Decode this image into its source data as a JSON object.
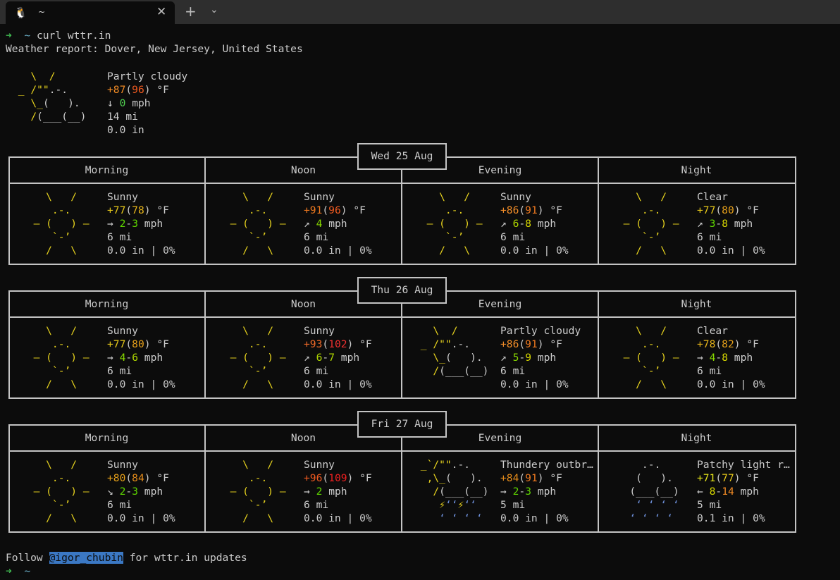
{
  "tab": {
    "title": "~",
    "icon": "linux-penguin-icon",
    "close_icon": "close-icon",
    "new_tab_icon": "plus-icon",
    "dropdown_icon": "chevron-down-icon"
  },
  "prompt": {
    "arrow": "➜",
    "dir": "~",
    "command": "curl wttr.in"
  },
  "report_title": "Weather report: Dover, New Jersey, United States",
  "colors": {
    "text": "#cccccc",
    "sun": "#e6d21e",
    "cloud": "#cccccc",
    "rain": "#6c8ed8",
    "prompt_arrow": "#3fb950",
    "prompt_dir": "#6ab0c8",
    "link_bg": "#3b78c4"
  },
  "art": {
    "sunny": [
      [
        [
          "    \\   /    ",
          "sun"
        ]
      ],
      [
        [
          "     .-.     ",
          "sun"
        ]
      ],
      [
        [
          "  ― (   ) ―  ",
          "sun"
        ]
      ],
      [
        [
          "     `-’     ",
          "sun"
        ]
      ],
      [
        [
          "    /   \\    ",
          "sun"
        ]
      ]
    ],
    "partly_cloudy": [
      [
        [
          "   \\  /      ",
          "sun"
        ]
      ],
      [
        [
          " _ /\"\"",
          "sun"
        ],
        [
          ".-.    ",
          "cloud"
        ]
      ],
      [
        [
          "   \\_",
          "sun"
        ],
        [
          "(   ).  ",
          "cloud"
        ]
      ],
      [
        [
          "   /",
          "sun"
        ],
        [
          "(___(__) ",
          "cloud"
        ]
      ],
      [
        [
          "             ",
          "cloud"
        ]
      ]
    ],
    "thundery": [
      [
        [
          " _`/\"\"",
          "sun"
        ],
        [
          ".-.    ",
          "cloud"
        ]
      ],
      [
        [
          "  ,\\_",
          "sun"
        ],
        [
          "(   ).  ",
          "cloud"
        ]
      ],
      [
        [
          "   /",
          "sun"
        ],
        [
          "(___(__) ",
          "cloud"
        ]
      ],
      [
        [
          "    ⚡",
          "sun"
        ],
        [
          "‘‘",
          "rain"
        ],
        [
          "⚡",
          "sun"
        ],
        [
          "‘‘ ",
          "rain"
        ]
      ],
      [
        [
          "    ‘ ‘ ‘ ‘  ",
          "rain"
        ]
      ]
    ],
    "patchy_rain": [
      [
        [
          "     .-.     ",
          "cloud"
        ]
      ],
      [
        [
          "    (   ).   ",
          "cloud"
        ]
      ],
      [
        [
          "   (___(__)  ",
          "cloud"
        ]
      ],
      [
        [
          "    ‘ ‘ ‘ ‘  ",
          "rain"
        ]
      ],
      [
        [
          "   ‘ ‘ ‘ ‘   ",
          "rain"
        ]
      ]
    ]
  },
  "current": {
    "art": "partly_cloudy",
    "condition": "Partly cloudy",
    "temp": {
      "v": "+87",
      "c": "#f08a24"
    },
    "feels": {
      "v": "96",
      "c": "#f05a20"
    },
    "temp_unit": "°F",
    "wind_arrow": "↓",
    "wind": [
      {
        "v": "0",
        "c": "#4fd04f"
      }
    ],
    "wind_unit": "mph",
    "visibility": "14 mi",
    "precip": "0.0 in"
  },
  "days": [
    {
      "date": "Wed 25 Aug",
      "periods": [
        {
          "label": "Morning",
          "art": "sunny",
          "condition": "Sunny",
          "temp": {
            "v": "+77",
            "c": "#e6c81a"
          },
          "feels": {
            "v": "78",
            "c": "#e6b41a"
          },
          "wind_arrow": "→",
          "wind": [
            {
              "v": "2",
              "c": "#5fd700"
            },
            {
              "v": "3",
              "c": "#5fd700"
            }
          ],
          "visibility": "6 mi",
          "precip": "0.0 in | 0%"
        },
        {
          "label": "Noon",
          "art": "sunny",
          "condition": "Sunny",
          "temp": {
            "v": "+91",
            "c": "#f07a20"
          },
          "feels": {
            "v": "96",
            "c": "#f05a20"
          },
          "wind_arrow": "↗",
          "wind": [
            {
              "v": "4",
              "c": "#87d700"
            }
          ],
          "visibility": "6 mi",
          "precip": "0.0 in | 0%"
        },
        {
          "label": "Evening",
          "art": "sunny",
          "condition": "Sunny",
          "temp": {
            "v": "+86",
            "c": "#f08c28"
          },
          "feels": {
            "v": "91",
            "c": "#f07a20"
          },
          "wind_arrow": "↗",
          "wind": [
            {
              "v": "6",
              "c": "#afd700"
            },
            {
              "v": "8",
              "c": "#d7d700"
            }
          ],
          "visibility": "6 mi",
          "precip": "0.0 in | 0%"
        },
        {
          "label": "Night",
          "art": "sunny",
          "condition": "Clear",
          "temp": {
            "v": "+77",
            "c": "#e6c81a"
          },
          "feels": {
            "v": "80",
            "c": "#e6a01a"
          },
          "wind_arrow": "↗",
          "wind": [
            {
              "v": "3",
              "c": "#5fd700"
            },
            {
              "v": "8",
              "c": "#d7d700"
            }
          ],
          "visibility": "6 mi",
          "precip": "0.0 in | 0%"
        }
      ]
    },
    {
      "date": "Thu 26 Aug",
      "periods": [
        {
          "label": "Morning",
          "art": "sunny",
          "condition": "Sunny",
          "temp": {
            "v": "+77",
            "c": "#e6c81a"
          },
          "feels": {
            "v": "80",
            "c": "#e6a01a"
          },
          "wind_arrow": "→",
          "wind": [
            {
              "v": "4",
              "c": "#87d700"
            },
            {
              "v": "6",
              "c": "#afd700"
            }
          ],
          "visibility": "6 mi",
          "precip": "0.0 in | 0%"
        },
        {
          "label": "Noon",
          "art": "sunny",
          "condition": "Sunny",
          "temp": {
            "v": "+93",
            "c": "#f06a28"
          },
          "feels": {
            "v": "102",
            "c": "#f03030"
          },
          "wind_arrow": "↗",
          "wind": [
            {
              "v": "6",
              "c": "#afd700"
            },
            {
              "v": "7",
              "c": "#afd700"
            }
          ],
          "visibility": "6 mi",
          "precip": "0.0 in | 0%"
        },
        {
          "label": "Evening",
          "art": "partly_cloudy",
          "condition": "Partly cloudy",
          "temp": {
            "v": "+86",
            "c": "#f08c28"
          },
          "feels": {
            "v": "91",
            "c": "#f07a20"
          },
          "wind_arrow": "↗",
          "wind": [
            {
              "v": "5",
              "c": "#87d700"
            },
            {
              "v": "9",
              "c": "#d7d700"
            }
          ],
          "visibility": "6 mi",
          "precip": "0.0 in | 0%"
        },
        {
          "label": "Night",
          "art": "sunny",
          "condition": "Clear",
          "temp": {
            "v": "+78",
            "c": "#e6b41a"
          },
          "feels": {
            "v": "82",
            "c": "#e6a01a"
          },
          "wind_arrow": "→",
          "wind": [
            {
              "v": "4",
              "c": "#87d700"
            },
            {
              "v": "8",
              "c": "#d7d700"
            }
          ],
          "visibility": "6 mi",
          "precip": "0.0 in | 0%"
        }
      ]
    },
    {
      "date": "Fri 27 Aug",
      "periods": [
        {
          "label": "Morning",
          "art": "sunny",
          "condition": "Sunny",
          "temp": {
            "v": "+80",
            "c": "#e6a01a"
          },
          "feels": {
            "v": "84",
            "c": "#e68c1a"
          },
          "wind_arrow": "↘",
          "wind": [
            {
              "v": "2",
              "c": "#5fd700"
            },
            {
              "v": "3",
              "c": "#5fd700"
            }
          ],
          "visibility": "6 mi",
          "precip": "0.0 in | 0%"
        },
        {
          "label": "Noon",
          "art": "sunny",
          "condition": "Sunny",
          "temp": {
            "v": "+96",
            "c": "#f05a20"
          },
          "feels": {
            "v": "109",
            "c": "#f02020"
          },
          "wind_arrow": "→",
          "wind": [
            {
              "v": "2",
              "c": "#5fd700"
            }
          ],
          "visibility": "6 mi",
          "precip": "0.0 in | 0%"
        },
        {
          "label": "Evening",
          "art": "thundery",
          "condition": "Thundery outbr…",
          "temp": {
            "v": "+84",
            "c": "#e68c1a"
          },
          "feels": {
            "v": "91",
            "c": "#f07a20"
          },
          "wind_arrow": "→",
          "wind": [
            {
              "v": "2",
              "c": "#5fd700"
            },
            {
              "v": "3",
              "c": "#5fd700"
            }
          ],
          "visibility": "5 mi",
          "precip": "0.0 in | 0%"
        },
        {
          "label": "Night",
          "art": "patchy_rain",
          "condition": "Patchy light r…",
          "temp": {
            "v": "+71",
            "c": "#e6e61a"
          },
          "feels": {
            "v": "77",
            "c": "#e6c81a"
          },
          "wind_arrow": "←",
          "wind": [
            {
              "v": "8",
              "c": "#d7d700"
            },
            {
              "v": "14",
              "c": "#f08a24"
            }
          ],
          "visibility": "5 mi",
          "precip": "0.1 in | 0%"
        }
      ]
    }
  ],
  "temp_unit": "°F",
  "wind_unit": "mph",
  "footer": {
    "prefix": "Follow ",
    "handle": "@igor_chubin",
    "suffix": " for wttr.in updates"
  },
  "final_prompt": {
    "arrow": "➜",
    "dir": "~"
  }
}
